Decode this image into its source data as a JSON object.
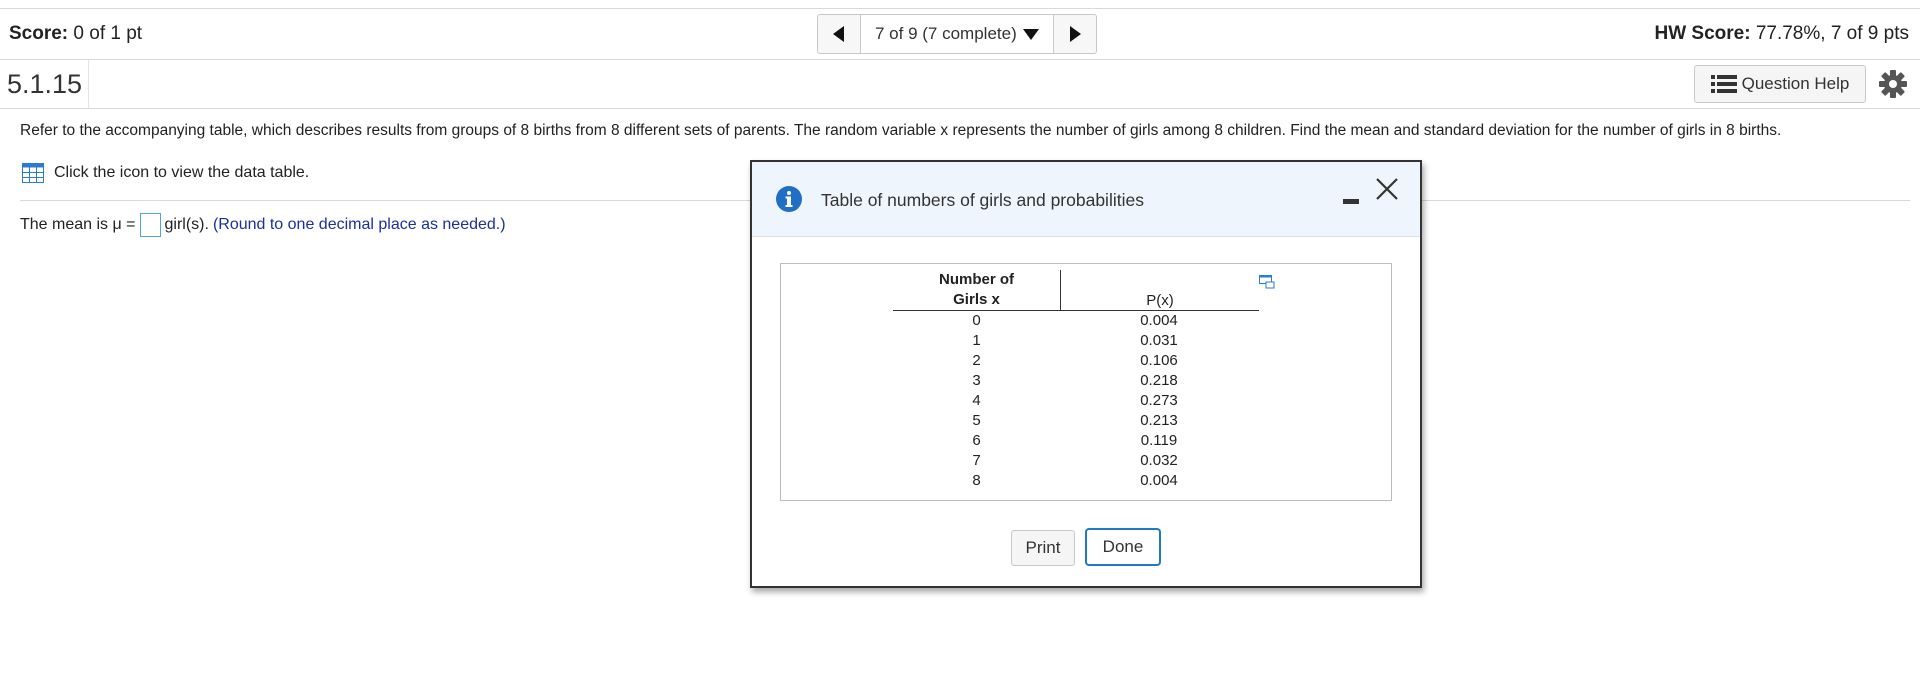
{
  "header": {
    "score_label": "Score:",
    "score_value": "0 of 1 pt",
    "nav_position": "7 of 9 (7 complete)",
    "hw_score_label": "HW Score:",
    "hw_score_value": "77.78%, 7 of 9 pts"
  },
  "question": {
    "number": "5.1.15",
    "help_label": "Question Help",
    "prompt": "Refer to the accompanying table, which describes results from groups of 8 births from 8 different sets of parents. The random variable x represents the number of girls among 8 children. Find the mean and standard deviation for the number of girls in 8 births.",
    "view_data_text": "Click the icon to view the data table.",
    "answer_prefix": "The mean is μ =",
    "answer_unit": "girl(s).",
    "answer_hint": "(Round to one decimal place as needed.)"
  },
  "dialog": {
    "title": "Table of numbers of girls and probabilities",
    "col1_header_line1": "Number of",
    "col1_header_line2": "Girls x",
    "col2_header": "P(x)",
    "rows": [
      {
        "x": "0",
        "p": "0.004"
      },
      {
        "x": "1",
        "p": "0.031"
      },
      {
        "x": "2",
        "p": "0.106"
      },
      {
        "x": "3",
        "p": "0.218"
      },
      {
        "x": "4",
        "p": "0.273"
      },
      {
        "x": "5",
        "p": "0.213"
      },
      {
        "x": "6",
        "p": "0.119"
      },
      {
        "x": "7",
        "p": "0.032"
      },
      {
        "x": "8",
        "p": "0.004"
      }
    ],
    "print_label": "Print",
    "done_label": "Done"
  },
  "colors": {
    "accent": "#1f78c8",
    "hint_text": "#1a2fa0",
    "dialog_header_bg": "#eef5fc"
  },
  "icons": [
    "prev-arrow-icon",
    "caret-down-icon",
    "next-arrow-icon",
    "list-icon",
    "gear-icon",
    "table-grid-icon",
    "info-icon",
    "minimize-icon",
    "close-icon",
    "popout-icon"
  ]
}
